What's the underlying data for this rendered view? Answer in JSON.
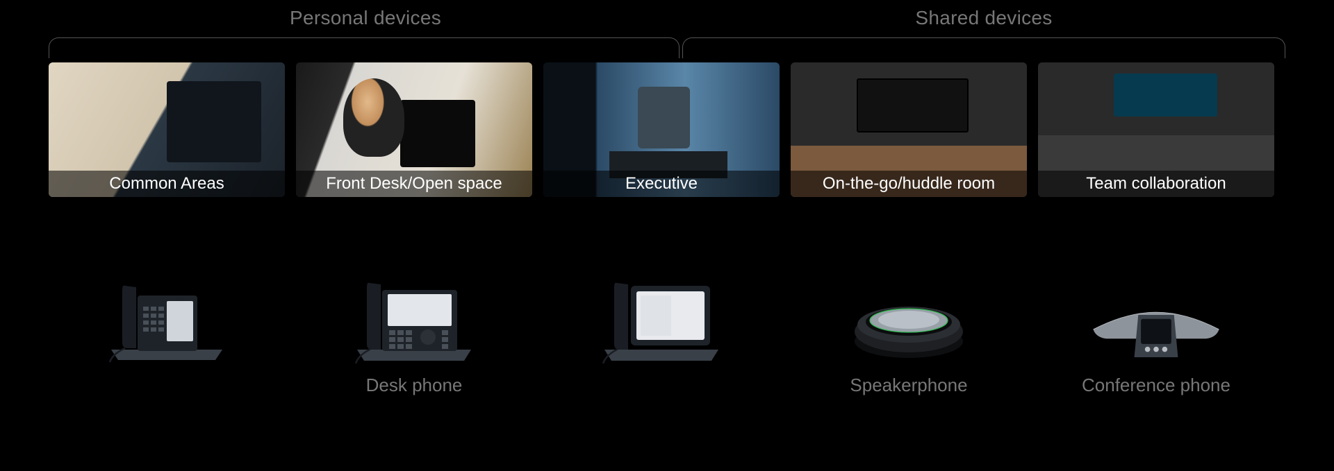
{
  "categories": {
    "personal": "Personal devices",
    "shared": "Shared devices"
  },
  "scenarios": [
    {
      "caption": "Common Areas"
    },
    {
      "caption": "Front Desk/Open space"
    },
    {
      "caption": "Executive"
    },
    {
      "caption": "On-the-go/huddle room"
    },
    {
      "caption": "Team collaboration"
    }
  ],
  "devices": [
    {
      "label": "",
      "type": "desk-phone-basic"
    },
    {
      "label": "Desk phone",
      "type": "desk-phone-buttons"
    },
    {
      "label": "",
      "type": "desk-phone-touch"
    },
    {
      "label": "Speakerphone",
      "type": "speakerphone"
    },
    {
      "label": "Conference phone",
      "type": "conference-phone"
    }
  ]
}
